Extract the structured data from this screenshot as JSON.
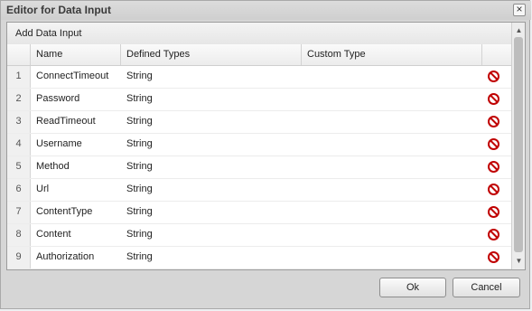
{
  "dialog": {
    "title": "Editor for Data Input",
    "close_glyph": "×"
  },
  "panel": {
    "add_label": "Add Data Input"
  },
  "table": {
    "columns": [
      "",
      "Name",
      "Defined Types",
      "Custom Type"
    ],
    "rows": [
      {
        "index": "1",
        "name": "ConnectTimeout",
        "type": "String"
      },
      {
        "index": "2",
        "name": "Password",
        "type": "String"
      },
      {
        "index": "3",
        "name": "ReadTimeout",
        "type": "String"
      },
      {
        "index": "4",
        "name": "Username",
        "type": "String"
      },
      {
        "index": "5",
        "name": "Method",
        "type": "String"
      },
      {
        "index": "6",
        "name": "Url",
        "type": "String"
      },
      {
        "index": "7",
        "name": "ContentType",
        "type": "String"
      },
      {
        "index": "8",
        "name": "Content",
        "type": "String"
      },
      {
        "index": "9",
        "name": "Authorization",
        "type": "String"
      }
    ],
    "delete_icon": "no-entry-icon",
    "delete_color": "#c00000"
  },
  "scrollbar": {
    "up_glyph": "▲",
    "down_glyph": "▼"
  },
  "buttons": {
    "ok": "Ok",
    "cancel": "Cancel"
  }
}
